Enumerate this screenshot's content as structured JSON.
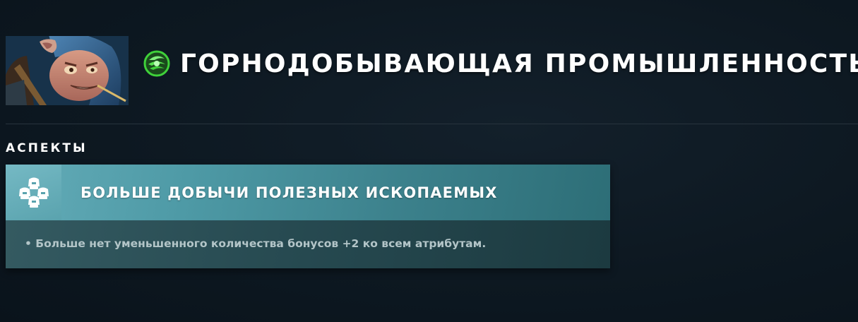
{
  "header": {
    "hero_name": "Meepo",
    "title": "ГОРНОДОБЫВАЮЩАЯ ПРОМЫШЛЕННОСТЬ",
    "title_icon": "green-swirl-icon"
  },
  "section": {
    "label": "АСПЕКТЫ"
  },
  "facet": {
    "icon": "helmets-cluster-icon",
    "title": "БОЛЬШЕ ДОБЫЧИ ПОЛЕЗНЫХ ИСКОПАЕМЫХ",
    "description": "• Больше нет уменьшенного количества бонусов +2 ко всем атрибутам."
  },
  "colors": {
    "background": "#0d1821",
    "facet_header": "#4e9aa6",
    "facet_body": "#264950",
    "title_icon_green": "#3fd13a"
  }
}
